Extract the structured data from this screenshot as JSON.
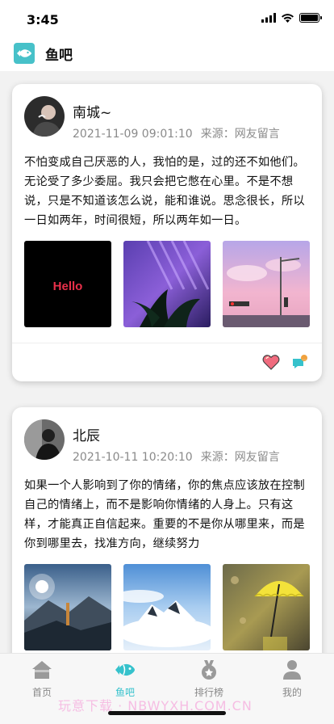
{
  "status_bar": {
    "time": "3:45"
  },
  "header": {
    "title": "鱼吧",
    "logo_icon": "fish-logo-icon",
    "accent": "#47c1c9"
  },
  "posts": [
    {
      "author": "南城~",
      "datetime": "2021-11-09 09:01:10",
      "source": "来源：网友留言",
      "text": "不怕变成自己厌恶的人，我怕的是，过的还不如他们。无论受了多少委屈。我只会把它憋在心里。不是不想说，只是不知道该怎么说，能和谁说。思念很长，所以一日如两年，时间很短，所以两年如一日。",
      "images": [
        {
          "caption": "Hello"
        },
        {
          "caption": ""
        },
        {
          "caption": ""
        }
      ],
      "like_icon": "heart-icon",
      "comment_icon": "comment-icon"
    },
    {
      "author": "北辰",
      "datetime": "2021-10-11 10:20:10",
      "source": "来源：网友留言",
      "text": "如果一个人影响到了你的情绪，你的焦点应该放在控制自己的情绪上，而不是影响你情绪的人身上。只有这样，才能真正自信起来。重要的不是你从哪里来，而是你到哪里去，找准方向，继续努力",
      "images": [
        {
          "caption": ""
        },
        {
          "caption": ""
        },
        {
          "caption": ""
        }
      ]
    }
  ],
  "tabs": [
    {
      "label": "首页",
      "icon": "home-icon"
    },
    {
      "label": "鱼吧",
      "icon": "fish-icon",
      "active": true
    },
    {
      "label": "排行榜",
      "icon": "medal-icon"
    },
    {
      "label": "我的",
      "icon": "user-icon"
    }
  ],
  "watermark": "玩意下载 · NBWYXH.COM.CN",
  "colors": {
    "active_tab": "#36c2cc",
    "muted_text": "#8a8a8a",
    "heart": "#f06b7e"
  }
}
